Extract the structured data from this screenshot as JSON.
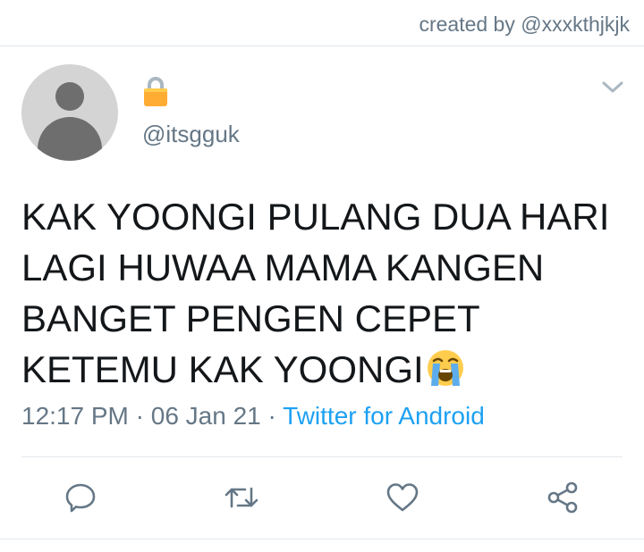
{
  "header": {
    "credit": "created by @xxxkthjkjk"
  },
  "tweet": {
    "handle": "@itsgguk",
    "locked": true,
    "text": "KAK YOONGI PULANG DUA HARI LAGI HUWAA MAMA KANGEN BANGET PENGEN CEPET KETEMU KAK YOONGI",
    "emoji": "loudly-crying-face",
    "time": "12:17 PM",
    "date": "06 Jan 21",
    "separator": "·",
    "source": "Twitter for Android"
  },
  "actions": [
    {
      "name": "reply-icon"
    },
    {
      "name": "retweet-icon"
    },
    {
      "name": "like-icon"
    },
    {
      "name": "share-icon"
    }
  ],
  "colors": {
    "secondary_text": "#657786",
    "link": "#1da1f2",
    "divider": "#e1e8ed",
    "lock": "#ffac33"
  }
}
